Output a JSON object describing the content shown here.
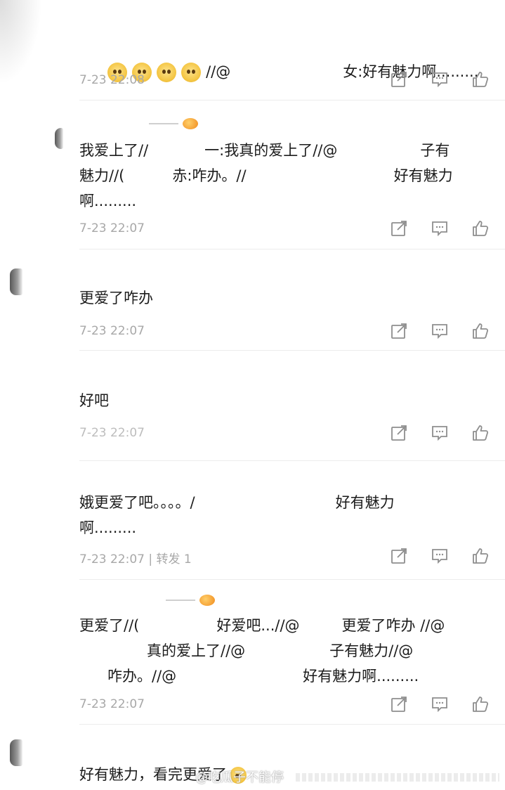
{
  "comments": [
    {
      "text_parts": [
        "//@",
        "女:好有魅力啊........."
      ],
      "emoji_count": 4,
      "meta": "7-23 22:08"
    },
    {
      "lines": [
        "我爱上了//",
        "一:我真的爱上了//@",
        "子有",
        "魅力//(",
        "赤:咋办。//",
        "好有魅力",
        "啊........."
      ],
      "meta": "7-23 22:07"
    },
    {
      "text": "更爱了咋办",
      "meta": "7-23 22:07"
    },
    {
      "text": "好吧",
      "meta": "7-23 22:07"
    },
    {
      "parts": [
        "娥更爱了吧。。。。/",
        "好有魅力",
        "啊........."
      ],
      "meta": "7-23 22:07 | 转发 1"
    },
    {
      "parts": [
        "更爱了//(",
        "好爱吧...//@",
        "更爱了咋办 //@",
        "真的爱上了//@",
        "子有魅力//@",
        "咋办。//@",
        "好有魅力啊........."
      ],
      "meta": "7-23 22:07"
    },
    {
      "text": "好有魅力，看完更爱了"
    }
  ],
  "icons": {
    "share": "share-icon",
    "comment": "comment-icon",
    "like": "like-icon"
  },
  "watermark": "@吃瓜子不能停",
  "colors": {
    "text": "#1c1c1c",
    "meta": "#a8a8a8",
    "icon": "#8e8e8e"
  }
}
